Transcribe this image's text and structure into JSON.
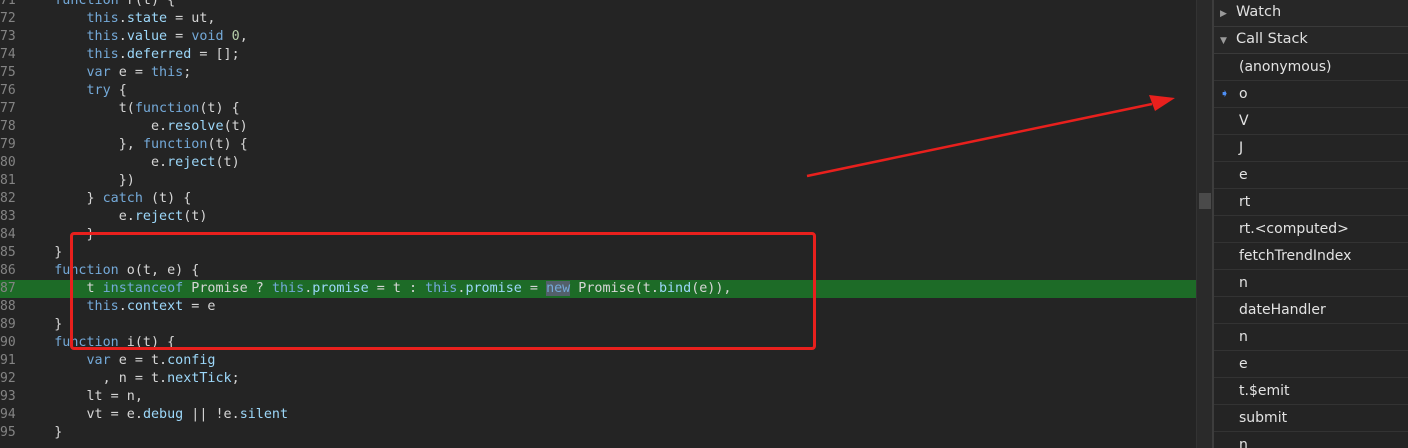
{
  "editor": {
    "lines": [
      {
        "n": "71",
        "html": "<span class=\"kw\">function</span> r(t) {"
      },
      {
        "n": "72",
        "html": "    <span class=\"kw\">this</span>.<span class=\"pr\">state</span> = ut,"
      },
      {
        "n": "73",
        "html": "    <span class=\"kw\">this</span>.<span class=\"pr\">value</span> = <span class=\"kw\">void</span> <span class=\"nm\">0</span>,"
      },
      {
        "n": "74",
        "html": "    <span class=\"kw\">this</span>.<span class=\"pr\">deferred</span> = [];"
      },
      {
        "n": "75",
        "html": "    <span class=\"kw\">var</span> e = <span class=\"kw\">this</span>;"
      },
      {
        "n": "76",
        "html": "    <span class=\"kw\">try</span> {"
      },
      {
        "n": "77",
        "html": "        t(<span class=\"kw\">function</span>(t) {"
      },
      {
        "n": "78",
        "html": "            e.<span class=\"pr\">resolve</span>(t)"
      },
      {
        "n": "79",
        "html": "        }, <span class=\"kw\">function</span>(t) {"
      },
      {
        "n": "80",
        "html": "            e.<span class=\"pr\">reject</span>(t)"
      },
      {
        "n": "81",
        "html": "        })"
      },
      {
        "n": "82",
        "html": "    } <span class=\"kw\">catch</span> (t) {"
      },
      {
        "n": "83",
        "html": "        e.<span class=\"pr\">reject</span>(t)"
      },
      {
        "n": "84",
        "html": "    }"
      },
      {
        "n": "85",
        "html": "}"
      },
      {
        "n": "86",
        "html": "<span class=\"kw\">function</span> o(t, e) {"
      },
      {
        "n": "87",
        "html": "    t <span class=\"kw\">instanceof</span> Promise ? <span class=\"kw\">this</span>.<span class=\"pr\">promise</span> = t : <span class=\"kw\">this</span>.<span class=\"pr\">promise</span> = <span class=\"kw hl\">new</span> Promise(t.<span class=\"pr\">bind</span>(e)),",
        "current": true
      },
      {
        "n": "88",
        "html": "    <span class=\"kw\">this</span>.<span class=\"pr\">context</span> = e"
      },
      {
        "n": "89",
        "html": "}"
      },
      {
        "n": "90",
        "html": "<span class=\"kw\">function</span> i(t) {"
      },
      {
        "n": "91",
        "html": "    <span class=\"kw\">var</span> e = t.<span class=\"pr\">config</span>"
      },
      {
        "n": "92",
        "html": "      , n = t.<span class=\"pr\">nextTick</span>;"
      },
      {
        "n": "93",
        "html": "    lt = n,"
      },
      {
        "n": "94",
        "html": "    vt = e.<span class=\"pr\">debug</span> || !e.<span class=\"pr\">silent</span>"
      },
      {
        "n": "95",
        "html": "}"
      }
    ]
  },
  "panel": {
    "watch_label": "Watch",
    "callstack_label": "Call Stack",
    "frames": [
      "(anonymous)",
      "o",
      "V",
      "J",
      "e",
      "rt",
      "rt.<computed>",
      "fetchTrendIndex",
      "n",
      "dateHandler",
      "n",
      "e",
      "t.$emit",
      "submit",
      "n"
    ],
    "current_frame_index": 1
  },
  "colors": {
    "annotation": "#e8201d",
    "current_line": "#1d6b27",
    "keyword": "#74a9d8",
    "property": "#9cd7f9"
  },
  "icons": {
    "collapsed": "triangle-right-icon",
    "expanded": "triangle-down-icon",
    "current_frame": "current-frame-arrow-icon"
  }
}
